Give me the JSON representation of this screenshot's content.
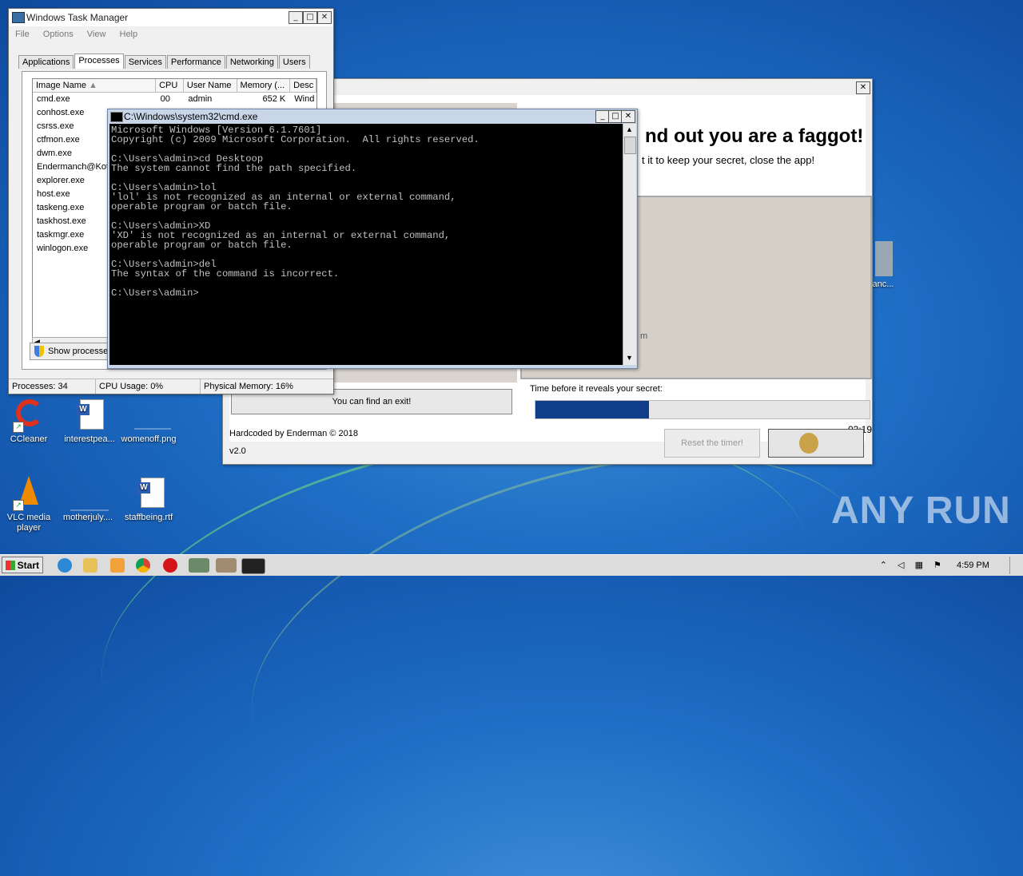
{
  "desktop": {
    "icons": [
      {
        "label": "CCleaner"
      },
      {
        "label": "interestpea..."
      },
      {
        "label": "womenoff.png"
      },
      {
        "label": "VLC media player"
      },
      {
        "label": "motherjuly...."
      },
      {
        "label": "staffbeing.rtf"
      },
      {
        "label": "anc..."
      }
    ],
    "watermark": "ANY RUN"
  },
  "task_manager": {
    "title": "Windows Task Manager",
    "menu": [
      "File",
      "Options",
      "View",
      "Help"
    ],
    "tabs": [
      "Applications",
      "Processes",
      "Services",
      "Performance",
      "Networking",
      "Users"
    ],
    "active_tab": "Processes",
    "columns": [
      "Image Name",
      "CPU",
      "User Name",
      "Memory (...",
      "Desc"
    ],
    "processes": [
      {
        "name": "cmd.exe",
        "cpu": "00",
        "user": "admin",
        "memory": "652 K",
        "desc": "Wind"
      },
      {
        "name": "conhost.exe"
      },
      {
        "name": "csrss.exe"
      },
      {
        "name": "ctfmon.exe"
      },
      {
        "name": "dwm.exe"
      },
      {
        "name": "Endermanch@Kote"
      },
      {
        "name": "explorer.exe"
      },
      {
        "name": "host.exe"
      },
      {
        "name": "taskeng.exe"
      },
      {
        "name": "taskhost.exe"
      },
      {
        "name": "taskmgr.exe"
      },
      {
        "name": "winlogon.exe"
      }
    ],
    "show_button": "Show processe",
    "status": {
      "processes": "Processes: 34",
      "cpu": "CPU Usage: 0%",
      "memory": "Physical Memory: 16%"
    }
  },
  "app": {
    "headline": "nd out you are a faggot!",
    "subline": "t it to keep your secret, close the app!",
    "partial_text": "m",
    "time_label": "Time before it reveals your secret:",
    "progress_fraction": 0.34,
    "timer": "03:19",
    "exit_button": "You can find an exit!",
    "credit": "Hardcoded by Enderman © 2018",
    "version": "v2.0",
    "reset_button": "Reset the timer!"
  },
  "cmd": {
    "title": "C:\\Windows\\system32\\cmd.exe",
    "lines": [
      "Microsoft Windows [Version 6.1.7601]",
      "Copyright (c) 2009 Microsoft Corporation.  All rights reserved.",
      "",
      "C:\\Users\\admin>cd Desktoop",
      "The system cannot find the path specified.",
      "",
      "C:\\Users\\admin>lol",
      "'lol' is not recognized as an internal or external command,",
      "operable program or batch file.",
      "",
      "C:\\Users\\admin>XD",
      "'XD' is not recognized as an internal or external command,",
      "operable program or batch file.",
      "",
      "C:\\Users\\admin>del",
      "The syntax of the command is incorrect.",
      "",
      "C:\\Users\\admin>"
    ]
  },
  "taskbar": {
    "start": "Start",
    "clock": "4:59 PM"
  }
}
